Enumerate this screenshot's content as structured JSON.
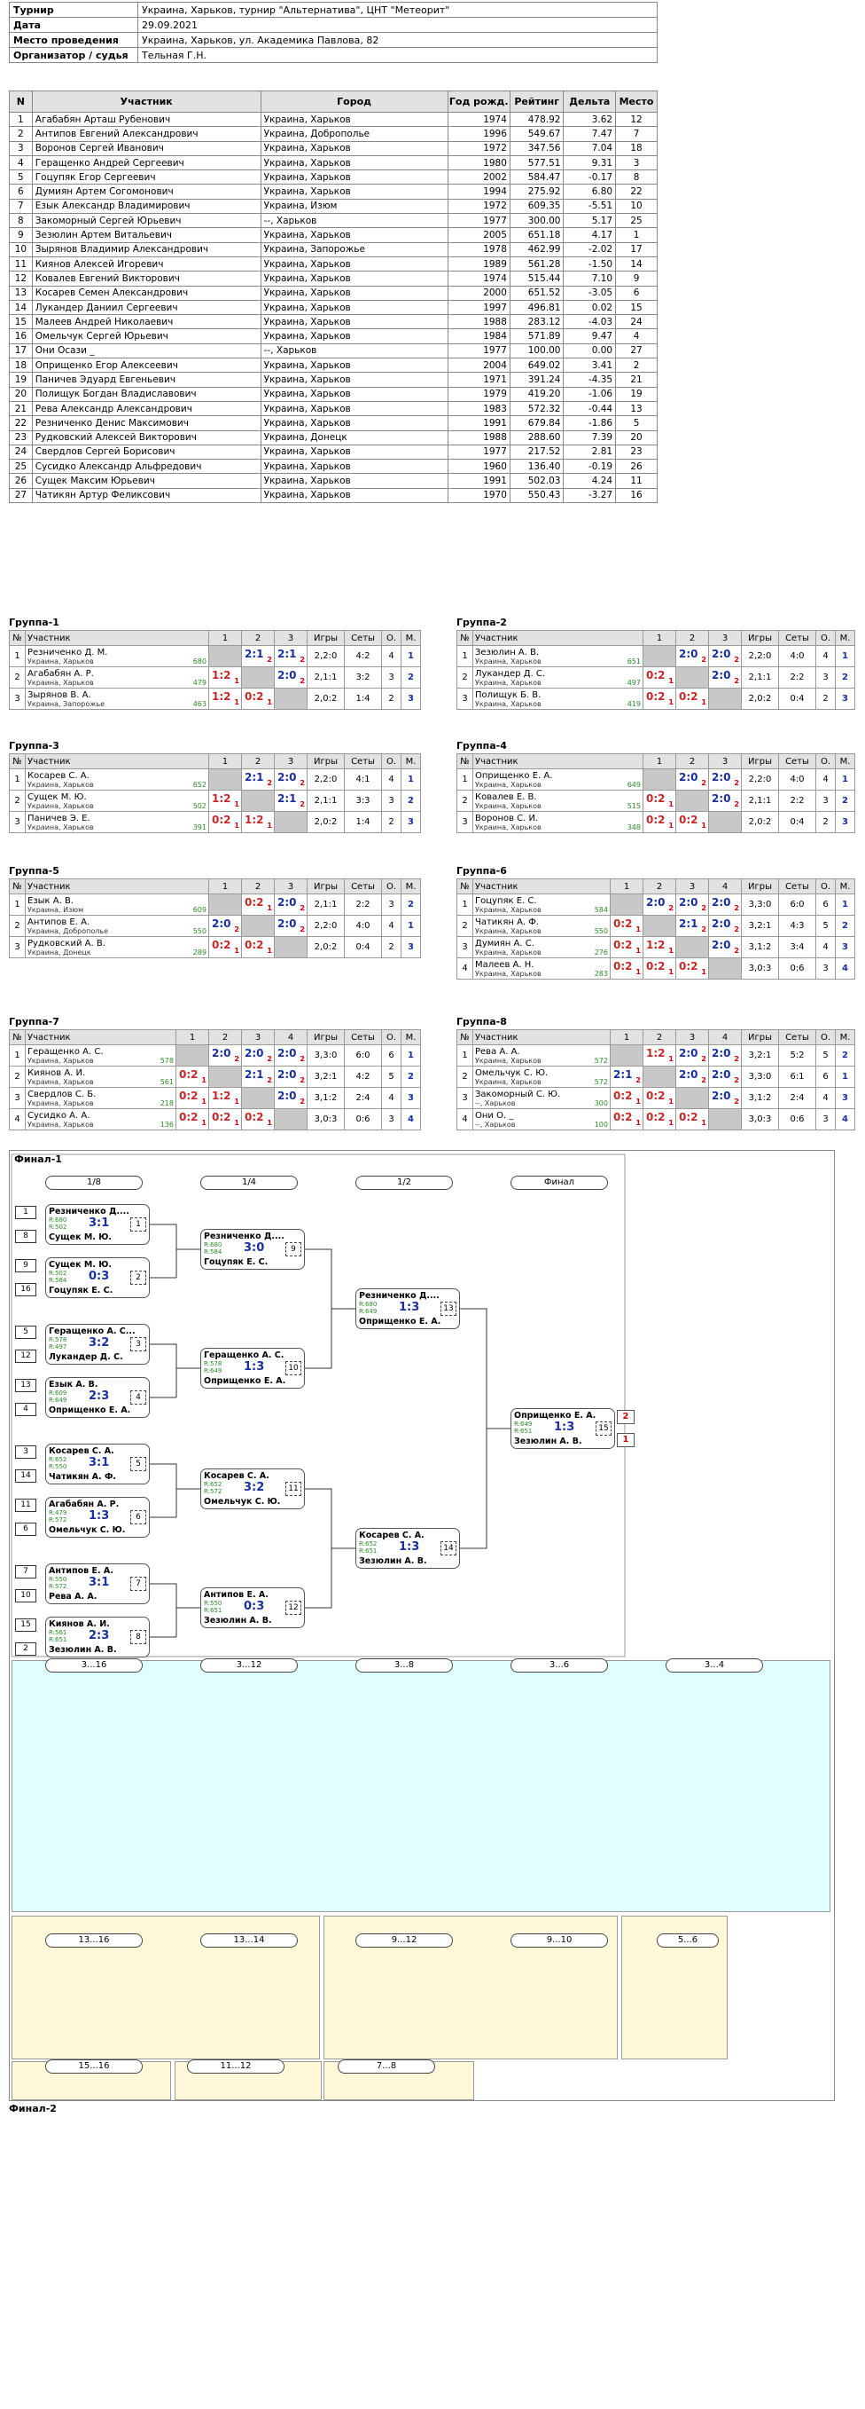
{
  "info": {
    "rows": [
      [
        "Турнир",
        "Украина, Харьков, турнир \"Альтернатива\", ЦНТ \"Метеорит\""
      ],
      [
        "Дата",
        "29.09.2021"
      ],
      [
        "Место проведения",
        "Украина, Харьков, ул. Академика Павлова, 82"
      ],
      [
        "Организатор / судья",
        "Тельная Г.Н."
      ]
    ]
  },
  "participants": {
    "headers": [
      "N",
      "Участник",
      "Город",
      "Год рожд.",
      "Рейтинг",
      "Дельта",
      "Место"
    ],
    "rows": [
      [
        "1",
        "Агабабян Арташ Рубенович",
        "Украина, Харьков",
        "1974",
        "478.92",
        "3.62",
        "12"
      ],
      [
        "2",
        "Антипов Евгений Александрович",
        "Украина, Доброполье",
        "1996",
        "549.67",
        "7.47",
        "7"
      ],
      [
        "3",
        "Воронов Сергей Иванович",
        "Украина, Харьков",
        "1972",
        "347.56",
        "7.04",
        "18"
      ],
      [
        "4",
        "Геращенко Андрей Сергеевич",
        "Украина, Харьков",
        "1980",
        "577.51",
        "9.31",
        "3"
      ],
      [
        "5",
        "Гоцупяк Егор Сергеевич",
        "Украина, Харьков",
        "2002",
        "584.47",
        "-0.17",
        "8"
      ],
      [
        "6",
        "Думиян Артем Согомонович",
        "Украина, Харьков",
        "1994",
        "275.92",
        "6.80",
        "22"
      ],
      [
        "7",
        "Езык Александр Владимирович",
        "Украина, Изюм",
        "1972",
        "609.35",
        "-5.51",
        "10"
      ],
      [
        "8",
        "Закоморный Сергей Юрьевич",
        "--, Харьков",
        "1977",
        "300.00",
        "5.17",
        "25"
      ],
      [
        "9",
        "Зезюлин Артем Витальевич",
        "Украина, Харьков",
        "2005",
        "651.18",
        "4.17",
        "1"
      ],
      [
        "10",
        "Зырянов Владимир Александрович",
        "Украина, Запорожье",
        "1978",
        "462.99",
        "-2.02",
        "17"
      ],
      [
        "11",
        "Киянов Алексей Игоревич",
        "Украина, Харьков",
        "1989",
        "561.28",
        "-1.50",
        "14"
      ],
      [
        "12",
        "Ковалев Евгений Викторович",
        "Украина, Харьков",
        "1974",
        "515.44",
        "7.10",
        "9"
      ],
      [
        "13",
        "Косарев Семен Александрович",
        "Украина, Харьков",
        "2000",
        "651.52",
        "-3.05",
        "6"
      ],
      [
        "14",
        "Лукандер Даниил Сергеевич",
        "Украина, Харьков",
        "1997",
        "496.81",
        "0.02",
        "15"
      ],
      [
        "15",
        "Малеев Андрей Николаевич",
        "Украина, Харьков",
        "1988",
        "283.12",
        "-4.03",
        "24"
      ],
      [
        "16",
        "Омельчук Сергей Юрьевич",
        "Украина, Харьков",
        "1984",
        "571.89",
        "9.47",
        "4"
      ],
      [
        "17",
        "Они Осази _",
        "--, Харьков",
        "1977",
        "100.00",
        "0.00",
        "27"
      ],
      [
        "18",
        "Оприщенко Егор Алексеевич",
        "Украина, Харьков",
        "2004",
        "649.02",
        "3.41",
        "2"
      ],
      [
        "19",
        "Паничев Эдуард Евгеньевич",
        "Украина, Харьков",
        "1971",
        "391.24",
        "-4.35",
        "21"
      ],
      [
        "20",
        "Полищук Богдан Владиславович",
        "Украина, Харьков",
        "1979",
        "419.20",
        "-1.06",
        "19"
      ],
      [
        "21",
        "Рева Александр Александрович",
        "Украина, Харьков",
        "1983",
        "572.32",
        "-0.44",
        "13"
      ],
      [
        "22",
        "Резниченко Денис Максимович",
        "Украина, Харьков",
        "1991",
        "679.84",
        "-1.86",
        "5"
      ],
      [
        "23",
        "Рудковский Алексей Викторович",
        "Украина, Донецк",
        "1988",
        "288.60",
        "7.39",
        "20"
      ],
      [
        "24",
        "Свердлов Сергей Борисович",
        "Украина, Харьков",
        "1977",
        "217.52",
        "2.81",
        "23"
      ],
      [
        "25",
        "Сусидко Александр Альфредович",
        "Украина, Харьков",
        "1960",
        "136.40",
        "-0.19",
        "26"
      ],
      [
        "26",
        "Сущек Максим Юрьевич",
        "Украина, Харьков",
        "1991",
        "502.03",
        "4.24",
        "11"
      ],
      [
        "27",
        "Чатикян Артур Феликсович",
        "Украина, Харьков",
        "1970",
        "550.43",
        "-3.27",
        "16"
      ]
    ]
  },
  "group_headers": {
    "no": "№",
    "name": "Участник",
    "games": "Игры",
    "sets": "Сеты",
    "o": "О.",
    "m": "М."
  },
  "groups": [
    {
      "title": "Группа-1",
      "cols": [
        "1",
        "2",
        "3"
      ],
      "rows": [
        {
          "n": "1",
          "name": "Резниченко Д. М.",
          "city": "Украина, Харьков",
          "r": "680",
          "cells": [
            "x",
            "2:1|2",
            "2:1|2"
          ],
          "games": "2,2:0",
          "sets": "4:2",
          "o": "4",
          "m": "1"
        },
        {
          "n": "2",
          "name": "Агабабян А. Р.",
          "city": "Украина, Харьков",
          "r": "479",
          "cells": [
            "1:2|1",
            "x",
            "2:0|2"
          ],
          "games": "2,1:1",
          "sets": "3:2",
          "o": "3",
          "m": "2"
        },
        {
          "n": "3",
          "name": "Зырянов В. А.",
          "city": "Украина, Запорожье",
          "r": "463",
          "cells": [
            "1:2|1",
            "0:2|1",
            "x"
          ],
          "games": "2,0:2",
          "sets": "1:4",
          "o": "2",
          "m": "3"
        }
      ]
    },
    {
      "title": "Группа-2",
      "cols": [
        "1",
        "2",
        "3"
      ],
      "rows": [
        {
          "n": "1",
          "name": "Зезюлин А. В.",
          "city": "Украина, Харьков",
          "r": "651",
          "cells": [
            "x",
            "2:0|2",
            "2:0|2"
          ],
          "games": "2,2:0",
          "sets": "4:0",
          "o": "4",
          "m": "1"
        },
        {
          "n": "2",
          "name": "Лукандер Д. С.",
          "city": "Украина, Харьков",
          "r": "497",
          "cells": [
            "0:2|1",
            "x",
            "2:0|2"
          ],
          "games": "2,1:1",
          "sets": "2:2",
          "o": "3",
          "m": "2"
        },
        {
          "n": "3",
          "name": "Полищук Б. В.",
          "city": "Украина, Харьков",
          "r": "419",
          "cells": [
            "0:2|1",
            "0:2|1",
            "x"
          ],
          "games": "2,0:2",
          "sets": "0:4",
          "o": "2",
          "m": "3"
        }
      ]
    },
    {
      "title": "Группа-3",
      "cols": [
        "1",
        "2",
        "3"
      ],
      "rows": [
        {
          "n": "1",
          "name": "Косарев С. А.",
          "city": "Украина, Харьков",
          "r": "652",
          "cells": [
            "x",
            "2:1|2",
            "2:0|2"
          ],
          "games": "2,2:0",
          "sets": "4:1",
          "o": "4",
          "m": "1"
        },
        {
          "n": "2",
          "name": "Сущек М. Ю.",
          "city": "Украина, Харьков",
          "r": "502",
          "cells": [
            "1:2|1",
            "x",
            "2:1|2"
          ],
          "games": "2,1:1",
          "sets": "3:3",
          "o": "3",
          "m": "2"
        },
        {
          "n": "3",
          "name": "Паничев Э. Е.",
          "city": "Украина, Харьков",
          "r": "391",
          "cells": [
            "0:2|1",
            "1:2|1",
            "x"
          ],
          "games": "2,0:2",
          "sets": "1:4",
          "o": "2",
          "m": "3"
        }
      ]
    },
    {
      "title": "Группа-4",
      "cols": [
        "1",
        "2",
        "3"
      ],
      "rows": [
        {
          "n": "1",
          "name": "Оприщенко Е. А.",
          "city": "Украина, Харьков",
          "r": "649",
          "cells": [
            "x",
            "2:0|2",
            "2:0|2"
          ],
          "games": "2,2:0",
          "sets": "4:0",
          "o": "4",
          "m": "1"
        },
        {
          "n": "2",
          "name": "Ковалев Е. В.",
          "city": "Украина, Харьков",
          "r": "515",
          "cells": [
            "0:2|1",
            "x",
            "2:0|2"
          ],
          "games": "2,1:1",
          "sets": "2:2",
          "o": "3",
          "m": "2"
        },
        {
          "n": "3",
          "name": "Воронов С. И.",
          "city": "Украина, Харьков",
          "r": "348",
          "cells": [
            "0:2|1",
            "0:2|1",
            "x"
          ],
          "games": "2,0:2",
          "sets": "0:4",
          "o": "2",
          "m": "3"
        }
      ]
    },
    {
      "title": "Группа-5",
      "cols": [
        "1",
        "2",
        "3"
      ],
      "rows": [
        {
          "n": "1",
          "name": "Езык А. В.",
          "city": "Украина, Изюм",
          "r": "609",
          "cells": [
            "x",
            "0:2|1",
            "2:0|2"
          ],
          "games": "2,1:1",
          "sets": "2:2",
          "o": "3",
          "m": "2"
        },
        {
          "n": "2",
          "name": "Антипов Е. А.",
          "city": "Украина, Доброполье",
          "r": "550",
          "cells": [
            "2:0|2",
            "x",
            "2:0|2"
          ],
          "games": "2,2:0",
          "sets": "4:0",
          "o": "4",
          "m": "1"
        },
        {
          "n": "3",
          "name": "Рудковский А. В.",
          "city": "Украина, Донецк",
          "r": "289",
          "cells": [
            "0:2|1",
            "0:2|1",
            "x"
          ],
          "games": "2,0:2",
          "sets": "0:4",
          "o": "2",
          "m": "3"
        }
      ]
    },
    {
      "title": "Группа-6",
      "cols": [
        "1",
        "2",
        "3",
        "4"
      ],
      "rows": [
        {
          "n": "1",
          "name": "Гоцупяк Е. С.",
          "city": "Украина, Харьков",
          "r": "584",
          "cells": [
            "x",
            "2:0|2",
            "2:0|2",
            "2:0|2"
          ],
          "games": "3,3:0",
          "sets": "6:0",
          "o": "6",
          "m": "1"
        },
        {
          "n": "2",
          "name": "Чатикян А. Ф.",
          "city": "Украина, Харьков",
          "r": "550",
          "cells": [
            "0:2|1",
            "x",
            "2:1|2",
            "2:0|2"
          ],
          "games": "3,2:1",
          "sets": "4:3",
          "o": "5",
          "m": "2"
        },
        {
          "n": "3",
          "name": "Думиян А. С.",
          "city": "Украина, Харьков",
          "r": "276",
          "cells": [
            "0:2|1",
            "1:2|1",
            "x",
            "2:0|2"
          ],
          "games": "3,1:2",
          "sets": "3:4",
          "o": "4",
          "m": "3"
        },
        {
          "n": "4",
          "name": "Малеев А. Н.",
          "city": "Украина, Харьков",
          "r": "283",
          "cells": [
            "0:2|1",
            "0:2|1",
            "0:2|1",
            "x"
          ],
          "games": "3,0:3",
          "sets": "0:6",
          "o": "3",
          "m": "4"
        }
      ]
    },
    {
      "title": "Группа-7",
      "cols": [
        "1",
        "2",
        "3",
        "4"
      ],
      "rows": [
        {
          "n": "1",
          "name": "Геращенко А. С.",
          "city": "Украина, Харьков",
          "r": "578",
          "cells": [
            "x",
            "2:0|2",
            "2:0|2",
            "2:0|2"
          ],
          "games": "3,3:0",
          "sets": "6:0",
          "o": "6",
          "m": "1"
        },
        {
          "n": "2",
          "name": "Киянов А. И.",
          "city": "Украина, Харьков",
          "r": "561",
          "cells": [
            "0:2|1",
            "x",
            "2:1|2",
            "2:0|2"
          ],
          "games": "3,2:1",
          "sets": "4:2",
          "o": "5",
          "m": "2"
        },
        {
          "n": "3",
          "name": "Свердлов С. Б.",
          "city": "Украина, Харьков",
          "r": "218",
          "cells": [
            "0:2|1",
            "1:2|1",
            "x",
            "2:0|2"
          ],
          "games": "3,1:2",
          "sets": "2:4",
          "o": "4",
          "m": "3"
        },
        {
          "n": "4",
          "name": "Сусидко А. А.",
          "city": "Украина, Харьков",
          "r": "136",
          "cells": [
            "0:2|1",
            "0:2|1",
            "0:2|1",
            "x"
          ],
          "games": "3,0:3",
          "sets": "0:6",
          "o": "3",
          "m": "4"
        }
      ]
    },
    {
      "title": "Группа-8",
      "cols": [
        "1",
        "2",
        "3",
        "4"
      ],
      "rows": [
        {
          "n": "1",
          "name": "Рева А. А.",
          "city": "Украина, Харьков",
          "r": "572",
          "cells": [
            "x",
            "1:2|1",
            "2:0|2",
            "2:0|2"
          ],
          "games": "3,2:1",
          "sets": "5:2",
          "o": "5",
          "m": "2"
        },
        {
          "n": "2",
          "name": "Омельчук С. Ю.",
          "city": "Украина, Харьков",
          "r": "572",
          "cells": [
            "2:1|2",
            "x",
            "2:0|2",
            "2:0|2"
          ],
          "games": "3,3:0",
          "sets": "6:1",
          "o": "6",
          "m": "1"
        },
        {
          "n": "3",
          "name": "Закоморный С. Ю.",
          "city": "--, Харьков",
          "r": "300",
          "cells": [
            "0:2|1",
            "0:2|1",
            "x",
            "2:0|2"
          ],
          "games": "3,1:2",
          "sets": "2:4",
          "o": "4",
          "m": "3"
        },
        {
          "n": "4",
          "name": "Они О. _",
          "city": "--, Харьков",
          "r": "100",
          "cells": [
            "0:2|1",
            "0:2|1",
            "0:2|1",
            "x"
          ],
          "games": "3,0:3",
          "sets": "0:6",
          "o": "3",
          "m": "4"
        }
      ]
    }
  ],
  "final1": {
    "title": "Финал-1",
    "rounds": [
      "1/8",
      "1/4",
      "1/2",
      "Финал",
      "3...16",
      "3...12",
      "3...8",
      "3...6",
      "3...4",
      "13...16",
      "13...14",
      "9...12",
      "9...10",
      "5...6",
      "15...16",
      "11...12",
      "7...8"
    ],
    "matches": [
      {
        "a": "Резниченко Д....",
        "ra": "R:680",
        "b": "Сущек М. Ю.",
        "rb": "R:502",
        "s": "3:1",
        "n": "1",
        "sa": "1",
        "sb": "8"
      },
      {
        "a": "Сущек М. Ю.",
        "ra": "R:502",
        "b": "Гоцупяк Е. С.",
        "rb": "R:584",
        "s": "0:3",
        "n": "2",
        "sa": "9",
        "sb": "16"
      },
      {
        "a": "Геращенко А. С...",
        "ra": "R:578",
        "b": "Лукандер Д. С.",
        "rb": "R:497",
        "s": "3:2",
        "n": "3",
        "sa": "5",
        "sb": "12"
      },
      {
        "a": "Езык А. В.",
        "ra": "R:609",
        "b": "Оприщенко Е. А.",
        "rb": "R:649",
        "s": "2:3",
        "n": "4",
        "sa": "13",
        "sb": "4"
      },
      {
        "a": "Косарев С. А.",
        "ra": "R:652",
        "b": "Чатикян А. Ф.",
        "rb": "R:550",
        "s": "3:1",
        "n": "5",
        "sa": "3",
        "sb": "14"
      },
      {
        "a": "Агабабян А. Р.",
        "ra": "R:479",
        "b": "Омельчук С. Ю.",
        "rb": "R:572",
        "s": "1:3",
        "n": "6",
        "sa": "11",
        "sb": "6"
      },
      {
        "a": "Антипов Е. А.",
        "ra": "R:550",
        "b": "Рева А. А.",
        "rb": "R:572",
        "s": "3:1",
        "n": "7",
        "sa": "7",
        "sb": "10"
      },
      {
        "a": "Киянов А. И.",
        "ra": "R:561",
        "b": "Зезюлин А. В.",
        "rb": "R:651",
        "s": "2:3",
        "n": "8",
        "sa": "15",
        "sb": "2"
      },
      {
        "a": "Резниченко Д....",
        "ra": "R:680",
        "b": "Гоцупяк Е. С.",
        "rb": "R:584",
        "s": "3:0",
        "n": "9"
      },
      {
        "a": "Геращенко А. С.",
        "ra": "R:578",
        "b": "Оприщенко Е. А.",
        "rb": "R:649",
        "s": "1:3",
        "n": "10"
      },
      {
        "a": "Косарев С. А.",
        "ra": "R:652",
        "b": "Омельчук С. Ю.",
        "rb": "R:572",
        "s": "3:2",
        "n": "11"
      },
      {
        "a": "Антипов Е. А.",
        "ra": "R:550",
        "b": "Зезюлин А. В.",
        "rb": "R:651",
        "s": "0:3",
        "n": "12"
      },
      {
        "a": "Резниченко Д....",
        "ra": "R:680",
        "b": "Оприщенко Е. А.",
        "rb": "R:649",
        "s": "1:3",
        "n": "13"
      },
      {
        "a": "Косарев С. А.",
        "ra": "R:652",
        "b": "Зезюлин А. В.",
        "rb": "R:651",
        "s": "1:3",
        "n": "14"
      },
      {
        "a": "Оприщенко Е. А.",
        "ra": "R:649",
        "b": "Зезюлин А. В.",
        "rb": "R:651",
        "s": "1:3",
        "n": "15"
      }
    ],
    "marks": {
      "first": "2",
      "second": "1"
    }
  },
  "final2": {
    "title": "Финал-2"
  }
}
